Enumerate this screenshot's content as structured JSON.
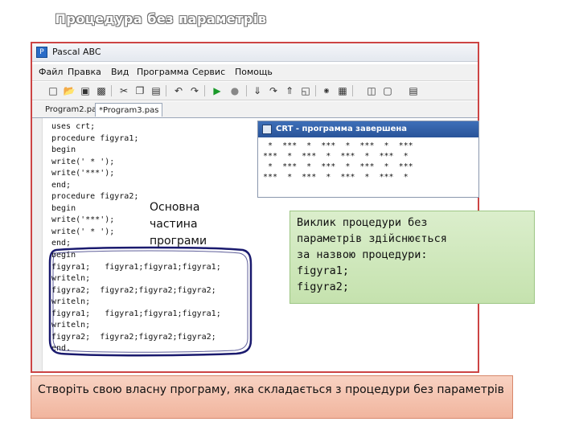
{
  "slide": {
    "title": "Процедура без параметрів"
  },
  "app": {
    "title": "Pascal ABC",
    "icon": "pascal-abc-icon",
    "menu": [
      "Файл",
      "Правка",
      "Вид",
      "Программа",
      "Сервис",
      "Помощь"
    ],
    "toolbar_icons": [
      "new-file-icon",
      "open-file-icon",
      "save-icon",
      "save-all-icon",
      "cut-icon",
      "copy-icon",
      "paste-icon",
      "undo-icon",
      "redo-icon",
      "run-icon",
      "stop-icon",
      "step-into-icon",
      "step-over-icon",
      "step-out-icon",
      "watch-icon",
      "breakpoint-icon",
      "grid-icon",
      "layout-icon",
      "window-icon",
      "help-icon"
    ],
    "tabs": [
      "Program2.pas",
      "*Program3.pas"
    ],
    "code_lines": [
      "uses crt;",
      "procedure figyra1;",
      "begin",
      "write(' * ');",
      "write('***');",
      "end;",
      "procedure figyra2;",
      "begin",
      "write('***');",
      "write(' * ');",
      "end;",
      "begin",
      "figyra1;   figyra1;figyra1;figyra1;",
      "writeln;",
      "figyra2;  figyra2;figyra2;figyra2;",
      "writeln;",
      "figyra1;   figyra1;figyra1;figyra1;",
      "writeln;",
      "figyra2;  figyra2;figyra2;figyra2;",
      "end."
    ]
  },
  "crt": {
    "title": "CRT - программа завершена",
    "output_lines": [
      " *  ***  *  ***  *  ***  *  ***",
      "***  *  ***  *  ***  *  ***  *",
      " *  ***  *  ***  *  ***  *  ***",
      "***  *  ***  *  ***  *  ***  *"
    ]
  },
  "annotations": {
    "main_part": [
      "Основна",
      "частина",
      "програми"
    ],
    "callout": [
      "Виклик процедури без",
      "параметрів здійснюється",
      "за назвою процедури:",
      "figyra1;",
      "figyra2;"
    ],
    "task": "Створіть свою власну програму, яка складається з процедури без параметрів"
  },
  "colors": {
    "window_border": "#cc4444",
    "crt_title_bar": "#2a5499",
    "callout_fill": "#c5e2ae",
    "task_fill": "#f1b59e",
    "bracket": "#1a1a6e"
  }
}
